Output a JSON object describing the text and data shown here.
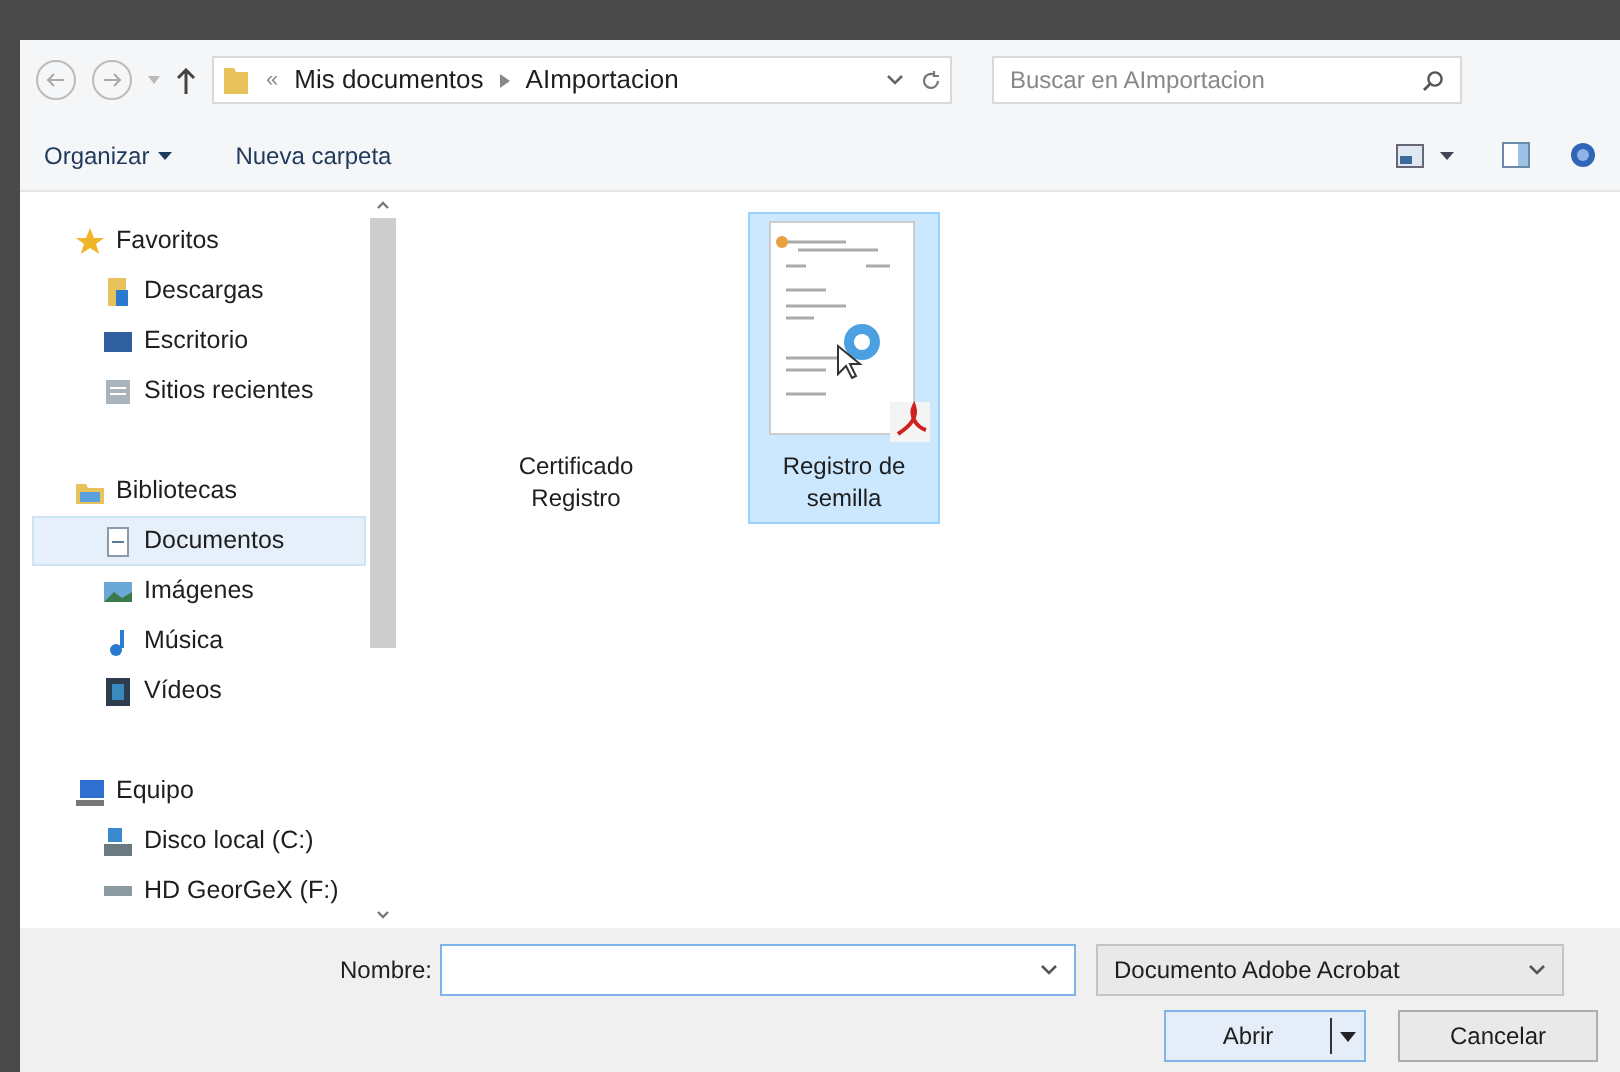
{
  "address_bar": {
    "separator": "«",
    "path": [
      "Mis documentos",
      "AImportacion"
    ]
  },
  "search": {
    "placeholder": "Buscar en AImportacion"
  },
  "toolbar": {
    "organize": "Organizar",
    "new_folder": "Nueva carpeta"
  },
  "sidebar": {
    "items": [
      {
        "label": "Favoritos",
        "kind": "star",
        "selected": false,
        "children": [
          {
            "label": "Descargas",
            "kind": "download",
            "selected": false
          },
          {
            "label": "Escritorio",
            "kind": "desktop",
            "selected": false
          },
          {
            "label": "Sitios recientes",
            "kind": "recent",
            "selected": false
          }
        ]
      },
      {
        "label": "Bibliotecas",
        "kind": "library",
        "selected": false,
        "children": [
          {
            "label": "Documentos",
            "kind": "document",
            "selected": true
          },
          {
            "label": "Imágenes",
            "kind": "image",
            "selected": false
          },
          {
            "label": "Música",
            "kind": "music",
            "selected": false
          },
          {
            "label": "Vídeos",
            "kind": "video",
            "selected": false
          }
        ]
      },
      {
        "label": "Equipo",
        "kind": "computer",
        "selected": false,
        "children": [
          {
            "label": "Disco local (C:)",
            "kind": "disk",
            "selected": false
          },
          {
            "label": "HD GeorGeX (F:)",
            "kind": "drive",
            "selected": false
          }
        ]
      }
    ]
  },
  "files": [
    {
      "name": "Certificado Registro",
      "thumbnail": false,
      "selected": false
    },
    {
      "name": "Registro de semilla",
      "thumbnail": true,
      "selected": true
    }
  ],
  "footer": {
    "name_label": "Nombre:",
    "file_type": "Documento Adobe Acrobat",
    "open": "Abrir",
    "cancel": "Cancelar"
  }
}
